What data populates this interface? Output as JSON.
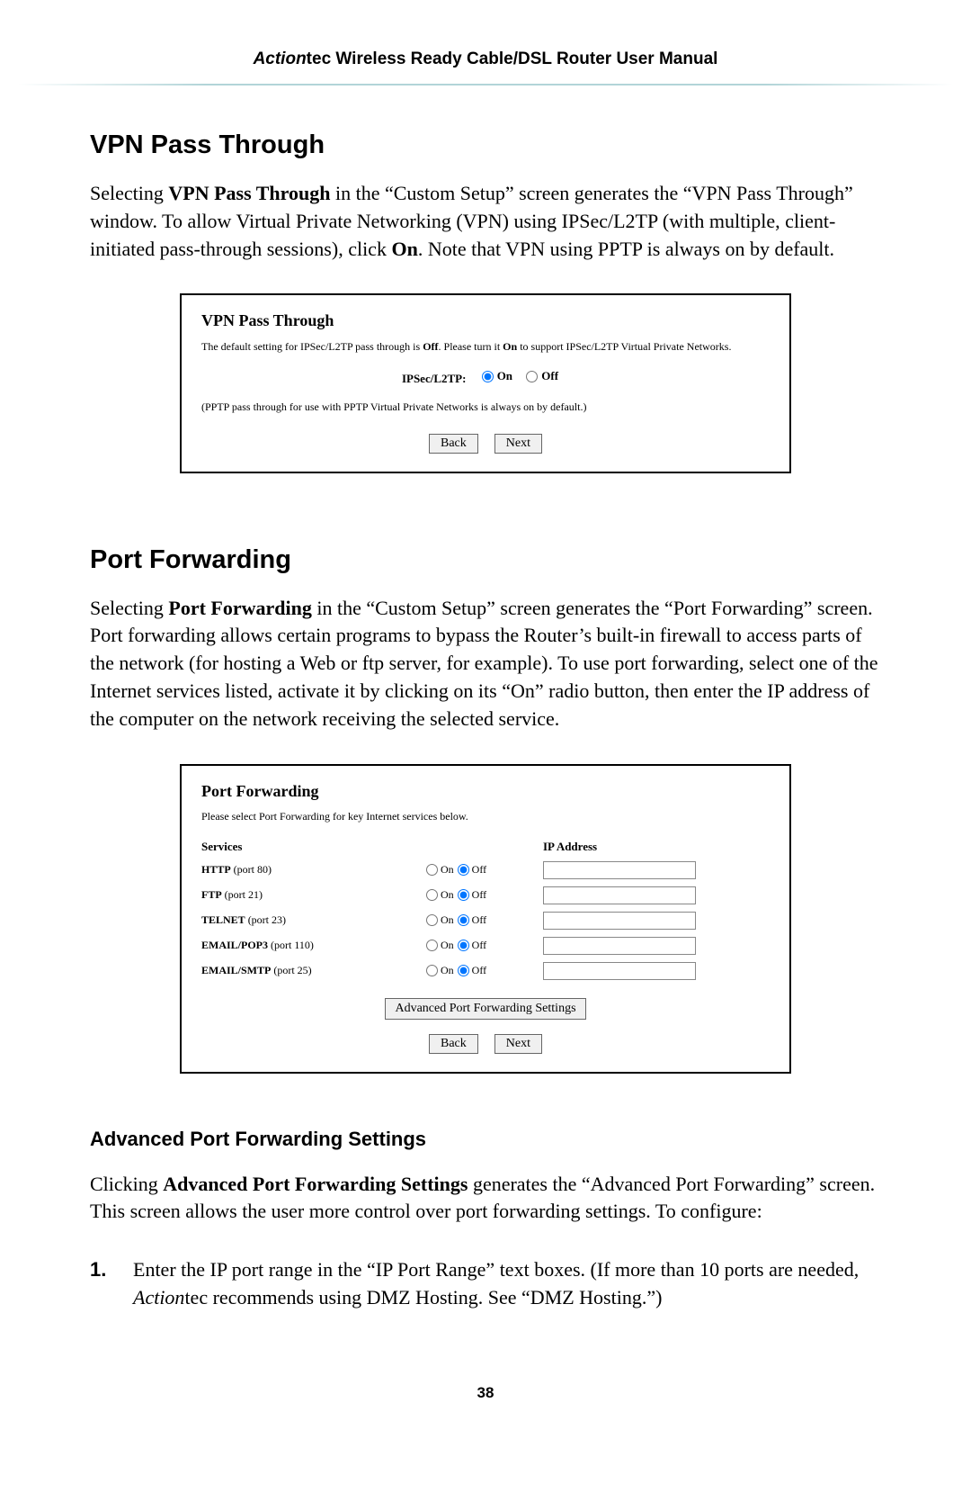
{
  "header": {
    "brand_italic": "Action",
    "brand_rest": "tec",
    "title_rest": " Wireless Ready Cable/DSL Router User Manual"
  },
  "section_vpn": {
    "heading": "VPN Pass Through",
    "para": {
      "p1": "Selecting ",
      "b1": "VPN Pass Through",
      "p2": " in the “Custom Setup” screen generates the “VPN Pass Through” window. To allow Virtual Private Networking (VPN) using IPSec/L2TP (with multiple, client-initiated pass-through sessions), click ",
      "b2": "On",
      "p3": ". Note that VPN using PPTP is always on by default."
    },
    "box": {
      "title": "VPN Pass Through",
      "note_p1": "The default setting for IPSec/L2TP pass through is ",
      "note_b1": "Off",
      "note_p2": ". Please turn it ",
      "note_b2": "On",
      "note_p3": " to support IPSec/L2TP Virtual Private Networks.",
      "field_label": "IPSec/L2TP:",
      "on_label": "On",
      "off_label": "Off",
      "on_checked": true,
      "pptp_note": "(PPTP pass through for use with PPTP Virtual Private Networks is always on by default.)",
      "back": "Back",
      "next": "Next"
    }
  },
  "section_pf": {
    "heading": "Port Forwarding",
    "para": {
      "p1": "Selecting ",
      "b1": "Port Forwarding",
      "p2": " in the “Custom Setup” screen generates the “Port Forwarding” screen. Port forwarding allows certain programs to bypass the Router’s built-in firewall to access parts of the network (for hosting a Web or ftp server, for example). To use port forwarding, select one of the Internet services listed, activate it by clicking on its “On” radio button, then enter the IP address of the computer on the network receiving the selected service."
    },
    "box": {
      "title": "Port Forwarding",
      "instr": "Please select Port Forwarding for key Internet services below.",
      "head_services": "Services",
      "head_ip": "IP  Address",
      "on_label": "On",
      "off_label": "Off",
      "rows": [
        {
          "name": "HTTP",
          "port": "(port 80)"
        },
        {
          "name": "FTP",
          "port": "(port 21)"
        },
        {
          "name": "TELNET",
          "port": "(port 23)"
        },
        {
          "name": "EMAIL/POP3",
          "port": "(port 110)"
        },
        {
          "name": "EMAIL/SMTP",
          "port": "(port 25)"
        }
      ],
      "adv_btn": "Advanced Port Forwarding Settings",
      "back": "Back",
      "next": "Next"
    }
  },
  "section_adv": {
    "heading": "Advanced Port Forwarding Settings",
    "para": {
      "p1": "Clicking ",
      "b1": "Advanced Port Forwarding Settings",
      "p2": " generates the “Advanced Port Forwarding” screen. This screen allows the user more control over port forwarding settings. To configure:"
    },
    "step1": {
      "num": "1.",
      "t1": "Enter the IP port range in the “IP Port Range” text boxes. (If more than 10 ports are needed, ",
      "brand_it": "Action",
      "brand_rest": "tec",
      "t2": " recommends using DMZ Hosting. See “DMZ Hosting.”)"
    }
  },
  "page_number": "38"
}
